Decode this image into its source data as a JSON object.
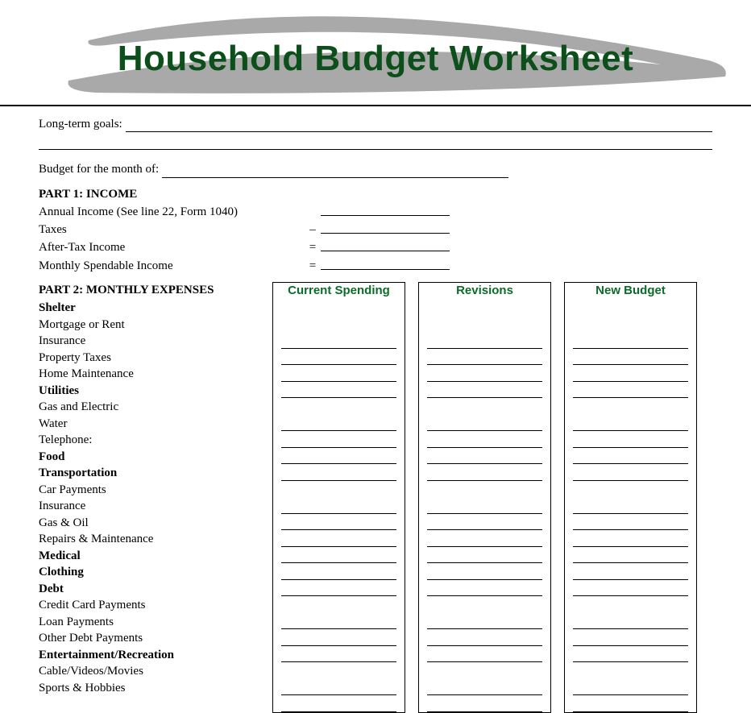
{
  "title": "Household Budget Worksheet",
  "fields": {
    "long_term_goals": "Long-term goals:",
    "budget_month": "Budget for the month of:"
  },
  "part1": {
    "heading": "PART 1: INCOME",
    "rows": [
      {
        "label": "Annual Income (See line 22, Form 1040)",
        "op": ""
      },
      {
        "label": "Taxes",
        "op": "–"
      },
      {
        "label": "After-Tax Income",
        "op": "="
      },
      {
        "label": "Monthly Spendable Income",
        "op": "="
      }
    ]
  },
  "part2": {
    "heading": "PART 2: MONTHLY EXPENSES",
    "columns": [
      "Current Spending",
      "Revisions",
      "New Budget"
    ],
    "rows": [
      {
        "label": "Shelter",
        "type": "cat",
        "blank": false
      },
      {
        "label": "Mortgage or Rent",
        "type": "item",
        "blank": true
      },
      {
        "label": "Insurance",
        "type": "item",
        "blank": true
      },
      {
        "label": "Property Taxes",
        "type": "item",
        "blank": true
      },
      {
        "label": "Home Maintenance",
        "type": "item",
        "blank": true
      },
      {
        "label": "Utilities",
        "type": "cat",
        "blank": false
      },
      {
        "label": "Gas and Electric",
        "type": "item",
        "blank": true
      },
      {
        "label": "Water",
        "type": "item",
        "blank": true
      },
      {
        "label": "Telephone:",
        "type": "item",
        "blank": true
      },
      {
        "label": "Food",
        "type": "cat",
        "blank": true
      },
      {
        "label": "Transportation",
        "type": "cat",
        "blank": false
      },
      {
        "label": "Car Payments",
        "type": "item",
        "blank": true
      },
      {
        "label": "Insurance",
        "type": "item",
        "blank": true
      },
      {
        "label": "Gas & Oil",
        "type": "item",
        "blank": true
      },
      {
        "label": "Repairs & Maintenance",
        "type": "item",
        "blank": true
      },
      {
        "label": "Medical",
        "type": "cat",
        "blank": true
      },
      {
        "label": "Clothing",
        "type": "cat",
        "blank": true
      },
      {
        "label": "Debt",
        "type": "cat",
        "blank": false
      },
      {
        "label": "Credit Card Payments",
        "type": "item",
        "blank": true
      },
      {
        "label": "Loan Payments",
        "type": "item",
        "blank": true
      },
      {
        "label": "Other Debt Payments",
        "type": "item",
        "blank": true
      },
      {
        "label": "Entertainment/Recreation",
        "type": "cat",
        "blank": false
      },
      {
        "label": "Cable/Videos/Movies",
        "type": "item",
        "blank": true
      },
      {
        "label": "Sports & Hobbies",
        "type": "item",
        "blank": true
      }
    ]
  }
}
